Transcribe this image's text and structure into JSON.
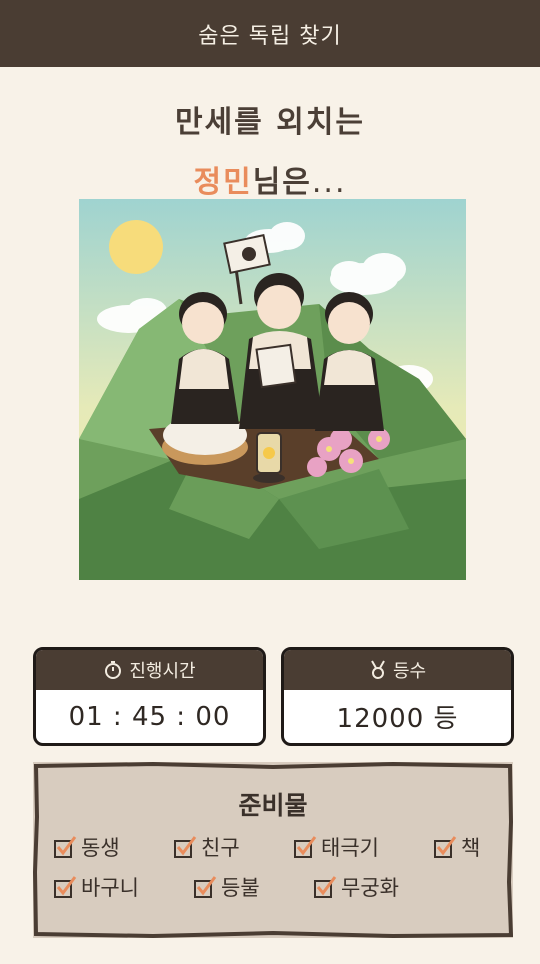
{
  "header": {
    "title": "숨은 독립 찾기"
  },
  "headline": {
    "line1": "만세를 외치는",
    "name": "정민",
    "line2_rest": "님은",
    "dots": "..."
  },
  "stats": {
    "time": {
      "label": "진행시간",
      "value": "01 : 45 : 00",
      "icon": "stopwatch-icon"
    },
    "rank": {
      "label": "등수",
      "value": "12000 등",
      "icon": "medal-icon"
    }
  },
  "supplies": {
    "title": "준비물",
    "items": [
      "동생",
      "친구",
      "태극기",
      "책",
      "바구니",
      "등불",
      "무궁화"
    ]
  },
  "colors": {
    "header_bg": "#4a3d33",
    "accent": "#e98c5c",
    "page_bg": "#f8f2e8",
    "panel_bg": "#d8ccbf",
    "check": "#e98c5c"
  }
}
